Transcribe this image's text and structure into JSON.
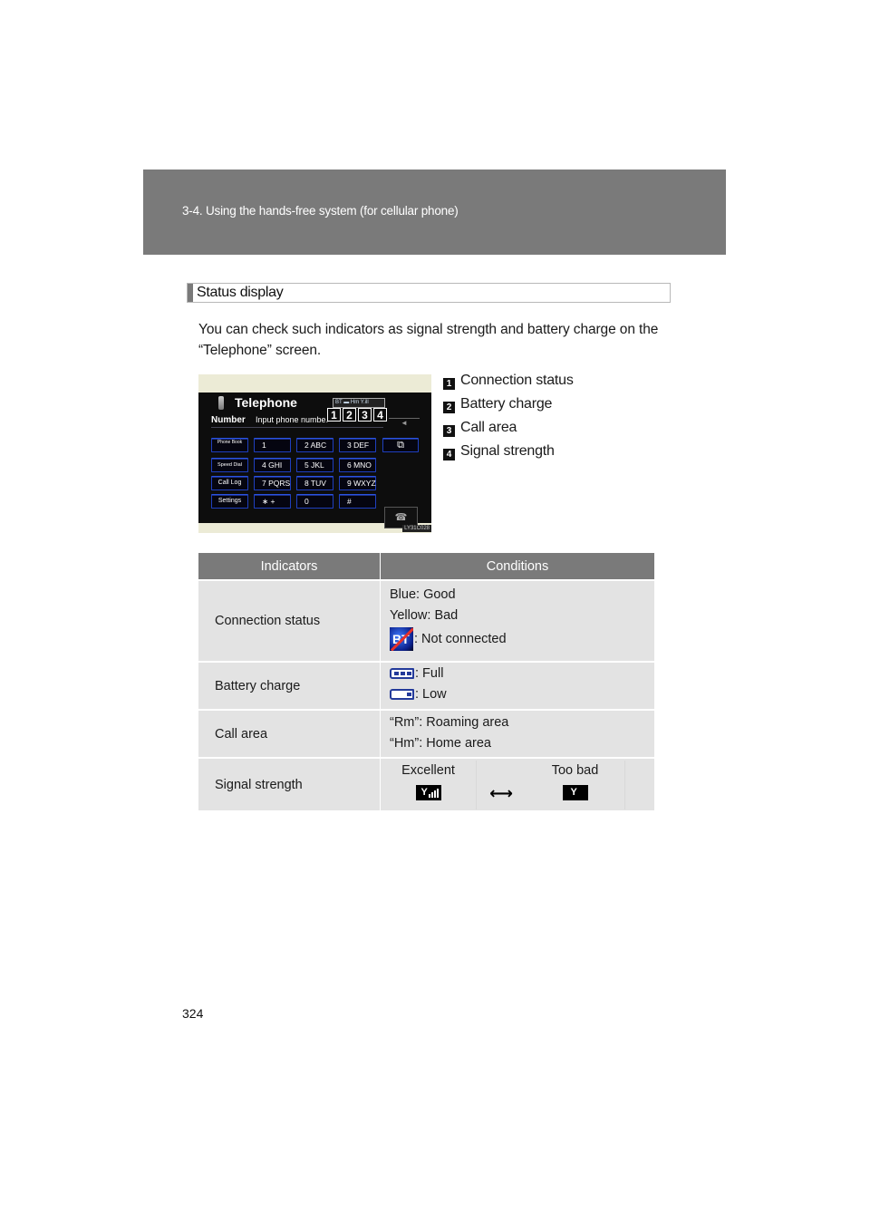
{
  "header": {
    "breadcrumb": "3-4. Using the hands-free system (for cellular phone)"
  },
  "section": {
    "title": "Status display",
    "intro": "You can check such indicators as signal strength and battery charge on the “Telephone” screen."
  },
  "telephone_screen": {
    "title": "Telephone",
    "status_strip": "BT ▬ Hm Y.ill",
    "number_label": "Number",
    "number_placeholder": "Input phone numbe.",
    "callouts": [
      "1",
      "2",
      "3",
      "4"
    ],
    "back_label": "◄",
    "function_keys": [
      "Phone Book",
      "Speed Dial",
      "Call Log",
      "Settings"
    ],
    "keypad": [
      [
        "1",
        "2 ABC",
        "3 DEF"
      ],
      [
        "4 GHI",
        "5 JKL",
        "6 MNO"
      ],
      [
        "7 PQRS",
        "8 TUV",
        "9 WXYZ"
      ],
      [
        "∗ +",
        "0",
        "#"
      ]
    ],
    "window_icon": "⧉",
    "hangup_icon": "☎",
    "image_code": "LY31C028"
  },
  "legend": [
    {
      "num": "1",
      "label": "Connection status"
    },
    {
      "num": "2",
      "label": "Battery charge"
    },
    {
      "num": "3",
      "label": "Call area"
    },
    {
      "num": "4",
      "label": "Signal strength"
    }
  ],
  "table": {
    "headers": [
      "Indicators",
      "Conditions"
    ],
    "rows": {
      "connection": {
        "indicator": "Connection status",
        "lines": [
          "Blue: Good",
          "Yellow: Bad"
        ],
        "icon_text": "BT",
        "icon_desc": ": Not connected"
      },
      "battery": {
        "indicator": "Battery charge",
        "full": ": Full",
        "low": ": Low"
      },
      "call_area": {
        "indicator": "Call area",
        "lines": [
          "“Rm”: Roaming area",
          "“Hm”: Home area"
        ]
      },
      "signal": {
        "indicator": "Signal strength",
        "best_label": "Excellent",
        "worst_label": "Too bad",
        "arrow": "⟷",
        "antenna": "Y"
      }
    }
  },
  "colors": {
    "header_gray": "#7a7a7a",
    "table_cell": "#e3e3e3",
    "battery_blue": "#233a9a",
    "bt_slash_red": "#e8302a",
    "key_border_blue": "#1f3fbf"
  },
  "page_number": "324"
}
